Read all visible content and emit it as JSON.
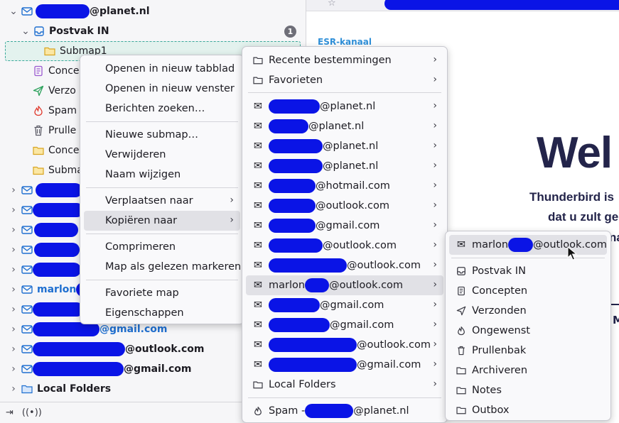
{
  "folder_pane": {
    "rows": [
      {
        "label": "@planet.nl",
        "type": "account-partial"
      },
      {
        "label": "Postvak IN",
        "badge": "1"
      },
      {
        "label": "Submap1"
      },
      {
        "label": "Conce"
      },
      {
        "label": "Verzo"
      },
      {
        "label": "Spam"
      },
      {
        "label": "Prulle"
      },
      {
        "label": "Conce"
      },
      {
        "label": "Subma"
      },
      {
        "label": "marlon"
      },
      {
        "label": "@gmail.com"
      },
      {
        "label": "@outlook.com"
      },
      {
        "label": "@gmail.com"
      },
      {
        "label": "Local Folders"
      }
    ]
  },
  "context_menu": {
    "open_tab": "Openen in nieuw tabblad",
    "open_window": "Openen in nieuw venster",
    "search": "Berichten zoeken…",
    "new_subfolder": "Nieuwe submap…",
    "delete": "Verwijderen",
    "rename": "Naam wijzigen",
    "move_to": "Verplaatsen naar",
    "copy_to": "Kopiëren naar",
    "compact": "Comprimeren",
    "mark_read": "Map als gelezen markeren",
    "favorite": "Favoriete map",
    "properties": "Eigenschappen"
  },
  "copy_menu": {
    "recent": "Recente bestemmingen",
    "favorites": "Favorieten",
    "accounts": [
      {
        "suffix": "@planet.nl"
      },
      {
        "suffix": "@planet.nl"
      },
      {
        "suffix": "@planet.nl"
      },
      {
        "suffix": "@planet.nl"
      },
      {
        "suffix": "@hotmail.com"
      },
      {
        "suffix": "@outlook.com"
      },
      {
        "suffix": "@gmail.com"
      },
      {
        "suffix": "@outlook.com"
      },
      {
        "suffix": "@outlook.com"
      },
      {
        "prefix": "marlon",
        "suffix": "@outlook.com"
      },
      {
        "suffix": "@gmail.com"
      },
      {
        "suffix": "@gmail.com"
      },
      {
        "suffix": "@outlook.com"
      },
      {
        "suffix": "@gmail.com"
      }
    ],
    "local_folders": "Local Folders",
    "spam_prefix": "Spam -",
    "spam_suffix": "@planet.nl"
  },
  "sub_menu": {
    "account_prefix": "marlon",
    "account_suffix": "@outlook.com",
    "items": [
      "Postvak IN",
      "Concepten",
      "Verzonden",
      "Ongewenst",
      "Prullenbak",
      "Archiveren",
      "Notes",
      "Outbox"
    ]
  },
  "content": {
    "esr": "ESR-kanaal",
    "welcome": "Wel",
    "line1": "Thunderbird is",
    "line2": "dat u zult ge",
    "line3": "na",
    "me": "Me"
  },
  "colors": {
    "accent": "#1f6fd0",
    "redaction": "#0a14e6",
    "heading": "#23244a"
  }
}
